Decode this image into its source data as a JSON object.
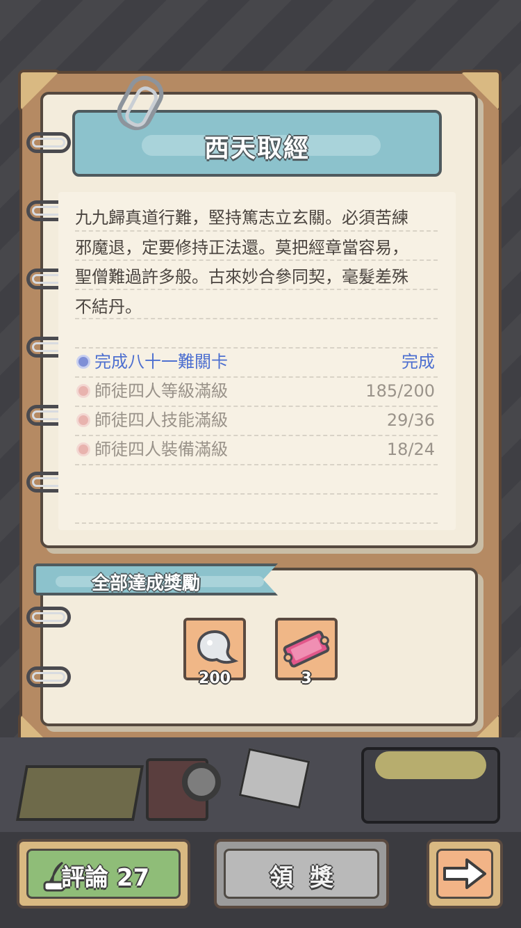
{
  "title": "西天取經",
  "description_lines": [
    "九九歸真道行難，堅持篤志立玄關。必須苦練",
    "邪魔退，定要修持正法還。莫把經章當容易，",
    "聖僧難過許多般。古來妙合參同契，毫髮差殊",
    "不結丹。"
  ],
  "tasks": [
    {
      "label": "完成八十一難關卡",
      "value": "完成",
      "done": true
    },
    {
      "label": "師徒四人等級滿級",
      "value": "185/200",
      "done": false
    },
    {
      "label": "師徒四人技能滿級",
      "value": "29/36",
      "done": false
    },
    {
      "label": "師徒四人裝備滿級",
      "value": "18/24",
      "done": false
    }
  ],
  "reward_section": {
    "title": "全部達成獎勵",
    "items": [
      {
        "icon": "spirit-icon",
        "count": "200"
      },
      {
        "icon": "ticket-icon",
        "count": "3"
      }
    ]
  },
  "buttons": {
    "comment_label": "評論 27",
    "claim_label": "領獎",
    "next_icon": "arrow-right-icon"
  },
  "colors": {
    "banner": "#8cc2cc",
    "paper": "#f3ecdc",
    "done_text": "#4d6fd0",
    "pending_text": "#9a938a",
    "comment_button": "#8fbd78",
    "claim_button": "#b9b9b9",
    "next_button": "#f2b487"
  }
}
